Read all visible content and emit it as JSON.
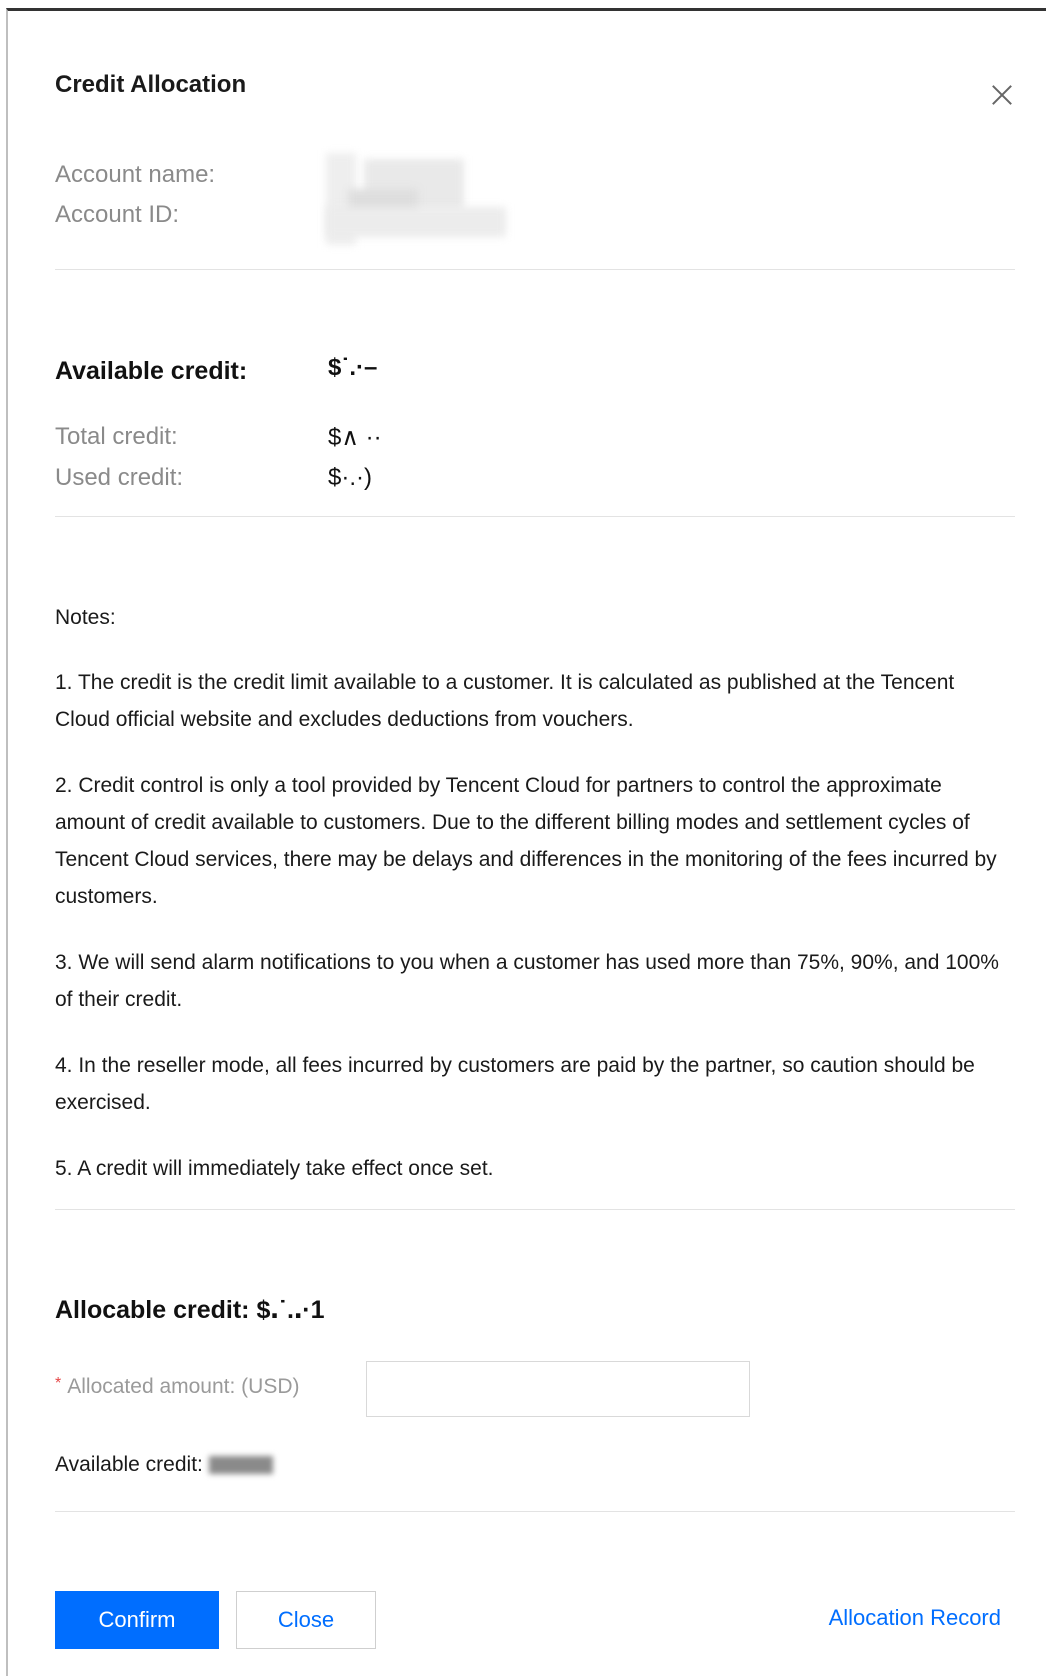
{
  "dialog": {
    "title": "Credit Allocation",
    "close_icon": "close-icon"
  },
  "account": {
    "name_label": "Account name:",
    "id_label": "Account ID:"
  },
  "credit": {
    "available_label": "Available credit:",
    "available_value": "$˙.·–",
    "total_label": "Total credit:",
    "total_value": "$∧ ··",
    "used_label": "Used credit:",
    "used_value": "$·.·)"
  },
  "notes": {
    "heading": "Notes:",
    "items": [
      "1. The credit is the credit limit available to a customer. It is calculated as published at the Tencent Cloud official website and excludes deductions from vouchers.",
      "2. Credit control is only a tool provided by Tencent Cloud for partners to control the approximate amount of credit available to customers. Due to the different billing modes and settlement cycles of Tencent Cloud services, there may be delays and differences in the monitoring of the fees incurred by customers.",
      "3. We will send alarm notifications to you when a customer has used more than 75%, 90%, and 100% of their credit.",
      "4. In the reseller mode, all fees incurred by customers are paid by the partner, so caution should be exercised.",
      "5. A credit will immediately take effect once set."
    ]
  },
  "allocation": {
    "allocable_label": "Allocable credit:",
    "allocable_value": "$․˙.․·1",
    "required_mark": "*",
    "amount_label": "Allocated amount: (USD)",
    "amount_value": "",
    "available_label": "Available credit:"
  },
  "footer": {
    "confirm_label": "Confirm",
    "close_label": "Close",
    "record_link": "Allocation Record"
  },
  "colors": {
    "primary": "#006eff",
    "required": "#e54545",
    "divider": "#e3e3e3"
  }
}
